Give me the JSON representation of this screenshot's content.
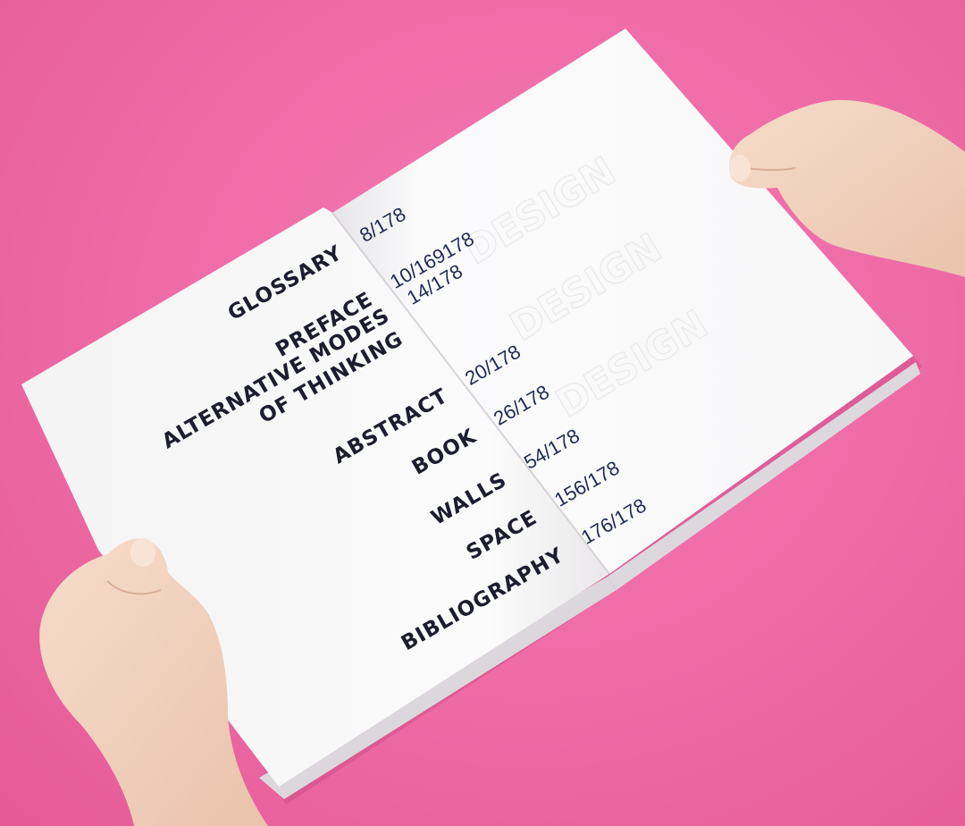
{
  "book": {
    "contents": [
      {
        "title_lines": [
          "GLOSSARY"
        ],
        "page": "8/178"
      },
      {
        "title_lines": [
          "PREFACE"
        ],
        "page": "10/169178"
      },
      {
        "title_lines": [
          "ALTERNATIVE MODES",
          "OF THINKING"
        ],
        "page": "14/178"
      },
      {
        "title_lines": [
          "ABSTRACT"
        ],
        "page": "20/178"
      },
      {
        "title_lines": [
          "BOOK"
        ],
        "page": "26/178"
      },
      {
        "title_lines": [
          "WALLS"
        ],
        "page": "54/178"
      },
      {
        "title_lines": [
          "SPACE"
        ],
        "page": "156/178"
      },
      {
        "title_lines": [
          "BIBLIOGRAPHY"
        ],
        "page": "176/178"
      }
    ]
  },
  "colors": {
    "background": "#ee6aa5",
    "paper": "#ffffff",
    "title_ink": "#1c1d2e",
    "page_ink": "#1f2a52"
  }
}
